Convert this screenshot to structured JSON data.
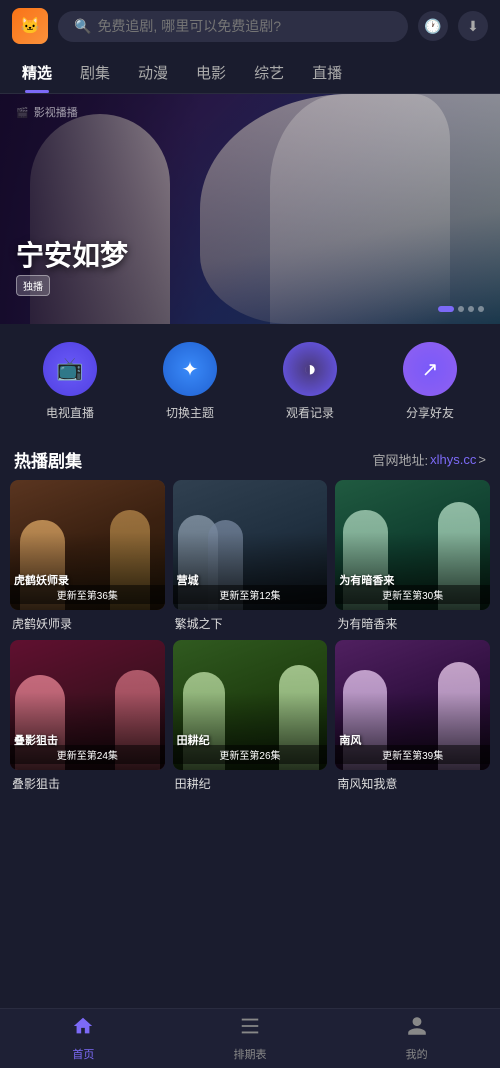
{
  "header": {
    "logo_icon": "🐱",
    "search_placeholder": "免费追剧, 哪里可以免费追剧?",
    "search_value": "",
    "icon_clock": "🕐",
    "icon_download": "⬇"
  },
  "nav": {
    "tabs": [
      {
        "label": "精选",
        "active": true
      },
      {
        "label": "剧集",
        "active": false
      },
      {
        "label": "动漫",
        "active": false
      },
      {
        "label": "电影",
        "active": false
      },
      {
        "label": "综艺",
        "active": false
      },
      {
        "label": "直播",
        "active": false
      }
    ]
  },
  "hero": {
    "title": "宁安如梦",
    "badge": "独播",
    "brand": "影视播播"
  },
  "quick_actions": [
    {
      "label": "电视直播",
      "icon": "📺",
      "class": "qa-tv"
    },
    {
      "label": "切换主题",
      "icon": "✦",
      "class": "qa-theme"
    },
    {
      "label": "观看记录",
      "icon": "◑",
      "class": "qa-history"
    },
    {
      "label": "分享好友",
      "icon": "↗",
      "class": "qa-share"
    }
  ],
  "hot_section": {
    "title": "热播剧集",
    "link_prefix": "官网地址:",
    "link_url": "xlhys.cc",
    "link_arrow": ">"
  },
  "dramas": [
    {
      "title": "虎鹤妖师录",
      "episode": "更新至第36集",
      "bg_class": "drama-bg-1",
      "overlay_title": "虎鹤妖师录"
    },
    {
      "title": "繁城之下",
      "episode": "更新至第12集",
      "bg_class": "drama-bg-2",
      "overlay_title": "营城"
    },
    {
      "title": "为有暗香来",
      "episode": "更新至第30集",
      "bg_class": "drama-bg-3",
      "overlay_title": "为有暗香来"
    },
    {
      "title": "叠影狙击",
      "episode": "更新至第24集",
      "bg_class": "drama-bg-4",
      "overlay_title": "叠影狙击"
    },
    {
      "title": "田耕纪",
      "episode": "更新至第26集",
      "bg_class": "drama-bg-5",
      "overlay_title": "田耕纪"
    },
    {
      "title": "南风知我意",
      "episode": "更新至第39集",
      "bg_class": "drama-bg-6",
      "overlay_title": "南风"
    }
  ],
  "bottom_nav": [
    {
      "label": "首页",
      "icon": "⌂",
      "active": true
    },
    {
      "label": "排期表",
      "icon": "☰",
      "active": false
    },
    {
      "label": "我的",
      "icon": "○",
      "active": false
    }
  ]
}
